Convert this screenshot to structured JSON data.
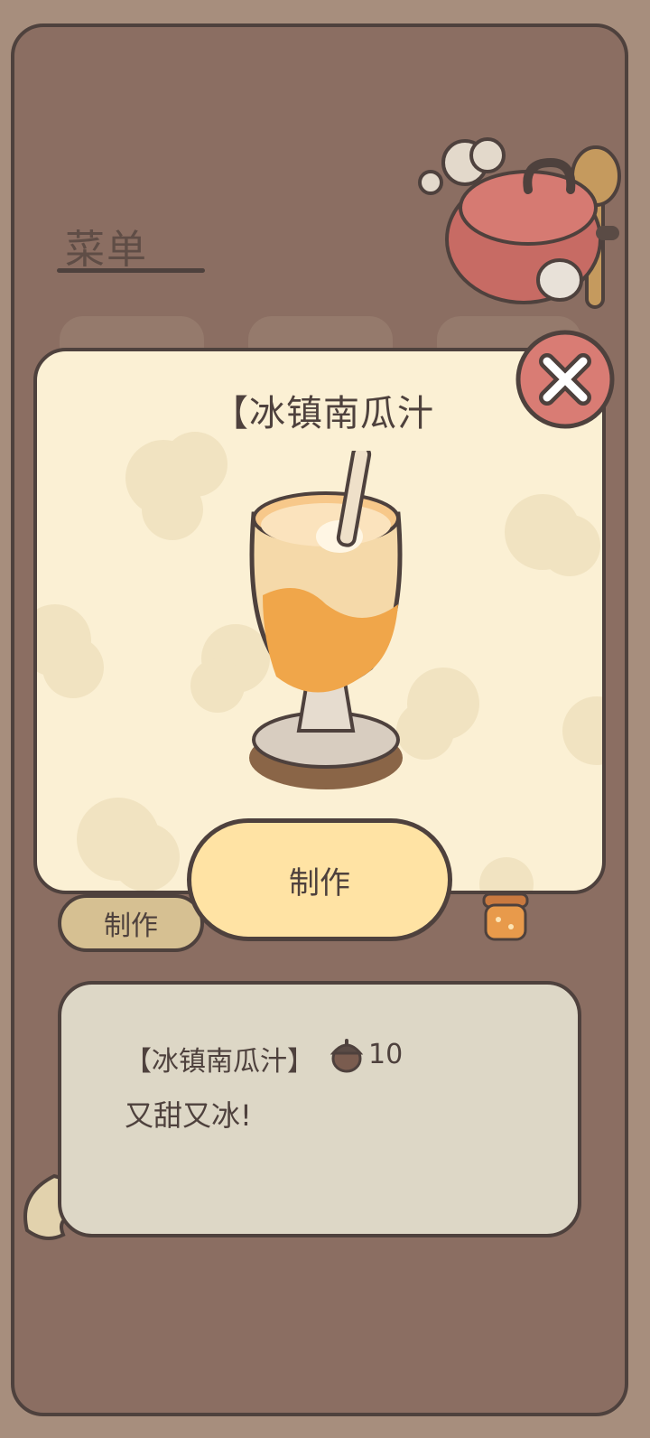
{
  "menu": {
    "title": "菜单"
  },
  "background_list": {
    "make_label": "制作"
  },
  "dialog": {
    "title": "【冰镇南瓜汁",
    "close_icon": "close-icon",
    "make_label": "制作"
  },
  "info": {
    "name": "【冰镇南瓜汁】",
    "price_icon": "acorn-icon",
    "price": "10",
    "description": "又甜又冰!"
  },
  "colors": {
    "frame": "#8b6e62",
    "outline": "#4e413d",
    "dialog_bg": "#fbf0d4",
    "make_button": "#ffe3a4",
    "close_button": "#d97c74",
    "info_panel": "#ddd7c6"
  }
}
